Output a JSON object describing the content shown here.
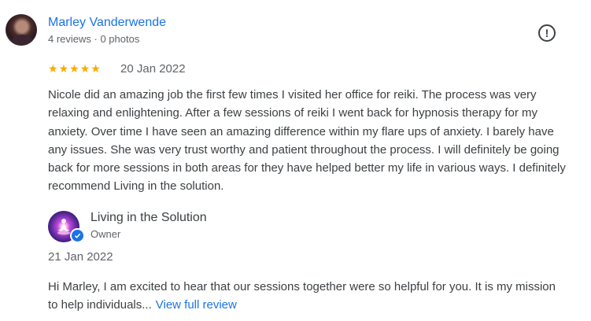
{
  "review": {
    "author": "Marley Vanderwende",
    "meta": "4 reviews · 0 photos",
    "rating": 5,
    "date": "20 Jan 2022",
    "text": "Nicole did an amazing job the first few times I visited her office for reiki. The process was very relaxing and enlightening. After a few sessions of reiki I went back for hypnosis therapy for my anxiety. Over time I have seen an amazing difference within my flare ups of anxiety. I barely have any issues. She was very trust worthy and patient throughout the process. I will definitely be going back for more sessions in both areas for they have helped better my life in various ways. I definitely recommend Living in the solution.",
    "report_icon": "flag-report-icon"
  },
  "reply": {
    "owner_name": "Living in the Solution",
    "owner_role": "Owner",
    "date": "21 Jan 2022",
    "text": "Hi Marley, I am excited to hear that our sessions together were so helpful for you. It is my mission to help individuals...",
    "view_full_label": "View full review"
  },
  "colors": {
    "link": "#1a73e8",
    "star": "#f9ab00",
    "text": "#3c4043",
    "secondary": "#5f6368"
  }
}
